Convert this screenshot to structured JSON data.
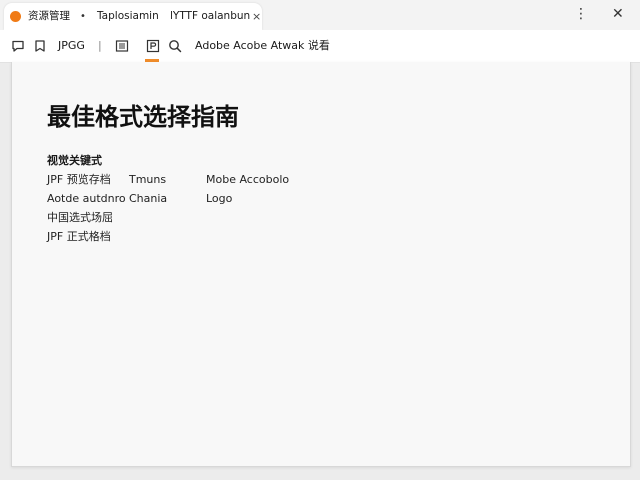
{
  "tab": {
    "title": "资源管理",
    "pinned_label": "Taplosiamin",
    "title2": "lYTTF oalanbun",
    "separator": "•",
    "close": "×"
  },
  "window": {
    "more": "⋮",
    "close": "✕"
  },
  "toolbar": {
    "format": "JPGG",
    "separator": "|",
    "document_title": "Adobe Acobe Atwak 说看"
  },
  "content": {
    "heading": "最佳格式选择指南",
    "subheading": "视觉关键式",
    "rows": [
      [
        "JPF 预览存档",
        "Tmuns",
        "Mobe Accobolo"
      ],
      [
        "Aotde autdnro",
        "Chania",
        "Logo"
      ],
      [
        "中国选式场屈",
        "",
        ""
      ],
      [
        "JPF 正式格档",
        "",
        ""
      ]
    ]
  },
  "colors": {
    "accent": "#f08c2a",
    "favicon": "#f07b16"
  },
  "icons": [
    "orange-dot-icon",
    "comment-icon",
    "bookmark-icon",
    "grid-icon",
    "page-icon",
    "search-icon",
    "more-icon",
    "close-icon"
  ]
}
